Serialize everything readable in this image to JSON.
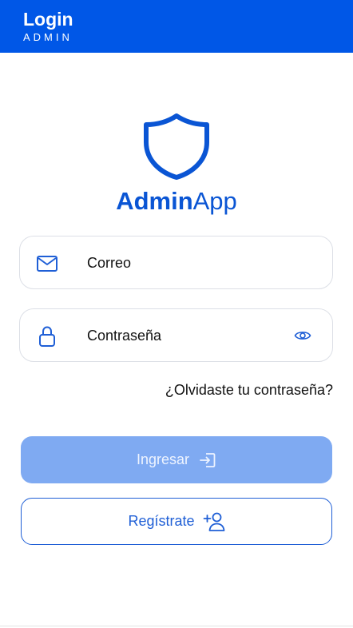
{
  "header": {
    "title": "Login",
    "subtitle": "ADMIN",
    "color": "#0057e7"
  },
  "brand": {
    "bold": "Admin",
    "regular": "App",
    "color": "#0a55d4"
  },
  "form": {
    "email": {
      "placeholder": "Correo",
      "icon": "mail-icon"
    },
    "password": {
      "placeholder": "Contraseña",
      "icon": "lock-icon",
      "toggle_icon": "eye-icon"
    },
    "forgot_link": "¿Olvidaste tu contraseña?"
  },
  "buttons": {
    "login": {
      "label": "Ingresar",
      "icon": "login-icon",
      "disabled": true
    },
    "register": {
      "label": "Regístrate",
      "icon": "add-user-icon"
    }
  }
}
